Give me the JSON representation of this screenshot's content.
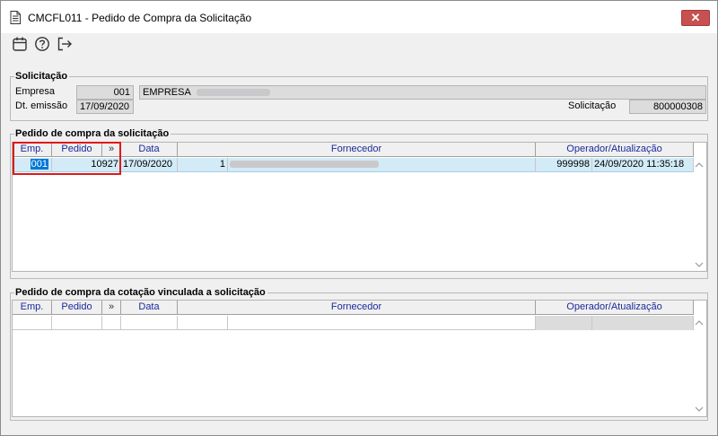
{
  "window": {
    "title": "CMCFL011 - Pedido de Compra da Solicitação",
    "close_label": "✕"
  },
  "toolbar": {
    "icons": [
      "calendar-icon",
      "help-icon",
      "exit-icon"
    ]
  },
  "solicitacao": {
    "group_title": "Solicitação",
    "empresa_label": "Empresa",
    "empresa_code": "001",
    "empresa_name": "EMPRESA",
    "dt_emissao_label": "Dt. emissão",
    "dt_emissao": "17/09/2020",
    "solicitacao_label": "Solicitação",
    "solicitacao_value": "800000308"
  },
  "pedido_solicitacao": {
    "group_title": "Pedido de compra da solicitação",
    "headers": [
      "Emp.",
      "Pedido",
      "»",
      "Data",
      "Fornecedor",
      "Operador/Atualização"
    ],
    "rows": [
      {
        "emp": "001",
        "pedido": "10927",
        "data": "17/09/2020",
        "forn_code": "1",
        "forn_name": "",
        "operador": "999998",
        "atualizacao": "24/09/2020 11:35:18"
      }
    ]
  },
  "pedido_cotacao": {
    "group_title": "Pedido de compra da cotação vinculada a solicitação",
    "headers": [
      "Emp.",
      "Pedido",
      "»",
      "Data",
      "Fornecedor",
      "Operador/Atualização"
    ]
  },
  "colors": {
    "header_text": "#1a2a9b",
    "selection": "#d2ebf7",
    "highlight_box": "#e01818",
    "selected_cell": "#0078d7"
  }
}
